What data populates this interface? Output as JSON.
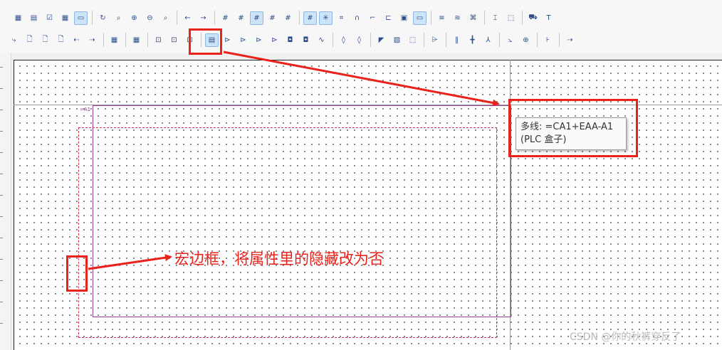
{
  "toolbar": {
    "row1": [
      {
        "name": "layout-icon",
        "glyph": "▦"
      },
      {
        "name": "window-icon",
        "glyph": "▤"
      },
      {
        "name": "check-page-icon",
        "glyph": "☑"
      },
      {
        "name": "table-icon",
        "glyph": "▦"
      },
      {
        "name": "monitor-icon",
        "glyph": "▭",
        "active": true
      },
      {
        "sep": true
      },
      {
        "name": "refresh-icon",
        "glyph": "↻"
      },
      {
        "name": "zoom-window-icon",
        "glyph": "⌕"
      },
      {
        "name": "zoom-in-icon",
        "glyph": "⊕"
      },
      {
        "name": "zoom-out-icon",
        "glyph": "⊖"
      },
      {
        "name": "zoom-100-icon",
        "glyph": "⌕"
      },
      {
        "sep": true
      },
      {
        "name": "back-arrow-icon",
        "glyph": "←"
      },
      {
        "name": "forward-arrow-icon",
        "glyph": "→"
      },
      {
        "sep": true
      },
      {
        "name": "grid-a-icon",
        "glyph": "#"
      },
      {
        "name": "grid-b-icon",
        "glyph": "#"
      },
      {
        "name": "grid-c-icon",
        "glyph": "#",
        "active": true
      },
      {
        "name": "grid-d-icon",
        "glyph": "#"
      },
      {
        "name": "grid-e-icon",
        "glyph": "#"
      },
      {
        "sep": true
      },
      {
        "name": "grid-show-icon",
        "glyph": "#",
        "active": true
      },
      {
        "name": "snap-grid-icon",
        "glyph": "✳",
        "active": true
      },
      {
        "name": "hash-icon",
        "glyph": "⌗"
      },
      {
        "name": "magnet-icon",
        "glyph": "∩"
      },
      {
        "name": "orthogonal-icon",
        "glyph": "⌐"
      },
      {
        "name": "connect-icon",
        "glyph": "⊏"
      },
      {
        "name": "image-icon",
        "glyph": "▣"
      },
      {
        "name": "input-box-icon",
        "glyph": "▭",
        "active": true
      },
      {
        "sep": true
      },
      {
        "name": "list-lines-icon",
        "glyph": "≡"
      },
      {
        "name": "wifi-lines-icon",
        "glyph": "≋"
      },
      {
        "name": "pattern-icon",
        "glyph": "⌘"
      },
      {
        "sep": true
      },
      {
        "name": "point-icon",
        "glyph": "⌶"
      },
      {
        "name": "select-area-icon",
        "glyph": "⬚"
      },
      {
        "sep": true
      },
      {
        "name": "cart-icon",
        "glyph": "⛟"
      },
      {
        "name": "text-t-icon",
        "glyph": "T"
      }
    ],
    "row2": [
      {
        "name": "doc-arrow-icon",
        "glyph": "⤷"
      },
      {
        "name": "new-doc-icon",
        "glyph": "🗋"
      },
      {
        "name": "doc-plus-icon",
        "glyph": "🗋"
      },
      {
        "name": "doc-pin-icon",
        "glyph": "🗋"
      },
      {
        "name": "doc-back-icon",
        "glyph": "⇠"
      },
      {
        "name": "doc-forward-icon",
        "glyph": "⇢"
      },
      {
        "sep": true
      },
      {
        "name": "grid-green-icon",
        "glyph": "▦"
      },
      {
        "sep": true
      },
      {
        "name": "grid-red-icon",
        "glyph": "▦"
      },
      {
        "sep": true
      },
      {
        "name": "circle-box-icon",
        "glyph": "⊡"
      },
      {
        "name": "circle-box-2-icon",
        "glyph": "⊡"
      },
      {
        "name": "circle-box-3-icon",
        "glyph": "⊡"
      },
      {
        "sep": true
      },
      {
        "name": "macro-frame-icon",
        "glyph": "▤",
        "active": true
      },
      {
        "name": "symbol-a-icon",
        "glyph": "⊳"
      },
      {
        "name": "symbol-b-icon",
        "glyph": "⊳"
      },
      {
        "name": "symbol-c-icon",
        "glyph": "⊳"
      },
      {
        "name": "symbol-d-icon",
        "glyph": "⊳"
      },
      {
        "name": "symbol-e-icon",
        "glyph": "◘"
      },
      {
        "name": "symbol-f-icon",
        "glyph": "◘"
      },
      {
        "name": "signal-icon",
        "glyph": "∿"
      },
      {
        "sep": true
      },
      {
        "name": "coil-a-icon",
        "glyph": "◊"
      },
      {
        "name": "coil-b-icon",
        "glyph": "◊"
      },
      {
        "sep": true
      },
      {
        "name": "corner-icon",
        "glyph": "◤"
      },
      {
        "name": "hatch-icon",
        "glyph": "▨"
      },
      {
        "name": "dashed-box-icon",
        "glyph": "⬚"
      },
      {
        "sep": true
      },
      {
        "name": "terminal-icon",
        "glyph": "⩥"
      },
      {
        "sep": true
      },
      {
        "name": "bus-a-icon",
        "glyph": "‖"
      },
      {
        "name": "cross-icon",
        "glyph": "╋"
      },
      {
        "name": "branch-icon",
        "glyph": "⅄"
      },
      {
        "sep": true
      },
      {
        "name": "angle-a-icon",
        "glyph": "⦣"
      },
      {
        "name": "angle-b-icon",
        "glyph": "⊕"
      },
      {
        "sep": true
      },
      {
        "name": "tee-icon",
        "glyph": "⊦"
      },
      {
        "sep": true
      },
      {
        "name": "arrow-tee-icon",
        "glyph": "⇢"
      }
    ]
  },
  "canvas": {
    "plc_box_label": "=A1",
    "tooltip_line1": "多线: =CA1+EAA-A1",
    "tooltip_line2": "(PLC 盒子)"
  },
  "annotation": {
    "text": "宏边框，将属性里的隐藏改为否"
  },
  "watermark": "CSDN @你的秋裤穿反了",
  "colors": {
    "annotation_red": "#e8231b",
    "plc_box": "#9b3f9b",
    "macro_frame": "#d0334d"
  }
}
